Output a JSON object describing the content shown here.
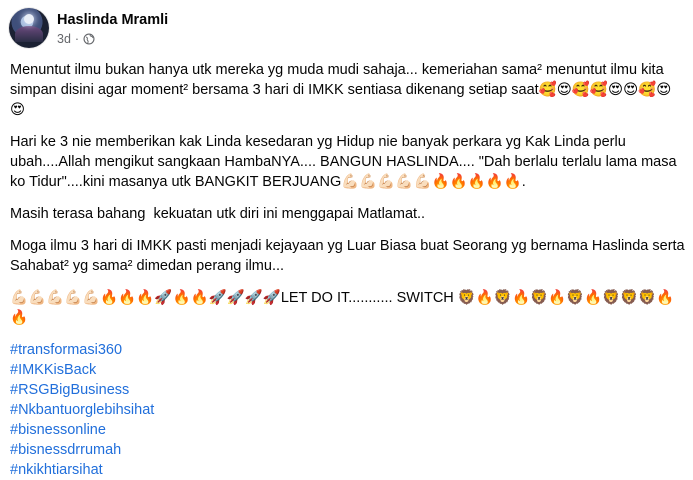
{
  "post": {
    "author_name": "Haslinda Mramli",
    "time": "3d",
    "separator": "·",
    "visibility_icon": "globe-icon",
    "paragraphs": [
      "Menuntut ilmu bukan hanya utk mereka yg muda mudi sahaja... kemeriahan sama² menuntut ilmu kita simpan disini agar moment² bersama 3 hari di IMKK sentiasa dikenang setiap saat🥰😍🥰🥰😍😍🥰😍😍",
      "Hari ke 3 nie memberikan kak Linda kesedaran yg Hidup nie banyak perkara yg Kak Linda perlu ubah....Allah mengikut sangkaan HambaNYA.... BANGUN HASLINDA.... \"Dah berlalu terlalu lama masa ko Tidur\"....kini masanya utk BANGKIT BERJUANG💪🏻💪🏻💪🏻💪🏻💪🏻🔥🔥🔥🔥🔥.",
      "Masih terasa bahang  kekuatan utk diri ini menggapai Matlamat..",
      "Moga ilmu 3 hari di IMKK pasti menjadi kejayaan yg Luar Biasa buat Seorang yg bernama Haslinda serta Sahabat² yg sama² dimedan perang ilmu...",
      "💪🏻💪🏻💪🏻💪🏻💪🏻🔥🔥🔥🚀🔥🔥🚀🚀🚀🚀LET DO IT........... SWITCH 🦁🔥🦁🔥🦁🔥🦁🔥🦁🦁🦁🔥🔥"
    ],
    "hashtags": [
      "#transformasi360",
      "#IMKKisBack",
      "#RSGBigBusiness",
      "#Nkbantuorglebihsihat",
      "#bisnessonline",
      "#bisnessdrrumah",
      "#nkikhtiarsihat"
    ]
  },
  "colors": {
    "hashtag": "#216fdb",
    "text": "#050505",
    "secondary": "#65676b"
  }
}
